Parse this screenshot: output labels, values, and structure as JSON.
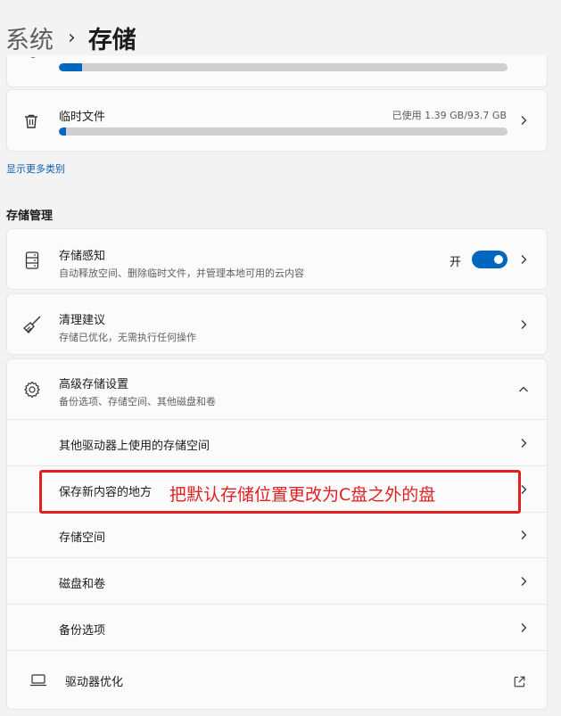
{
  "breadcrumb": {
    "parent": "系统",
    "separator": "›",
    "current": "存储"
  },
  "storage_items": [
    {
      "label": "",
      "usage": "",
      "fill_percent": 5
    },
    {
      "label": "临时文件",
      "usage": "已使用 1.39 GB/93.7 GB",
      "fill_percent": 1.5
    }
  ],
  "show_more_link": "显示更多类别",
  "storage_management": {
    "heading": "存储管理",
    "storage_sense": {
      "title": "存储感知",
      "desc": "自动释放空间、删除临时文件，并管理本地可用的云内容",
      "toggle_label": "开",
      "toggle_on": true
    },
    "cleanup": {
      "title": "清理建议",
      "desc": "存储已优化，无需执行任何操作"
    },
    "advanced": {
      "title": "高级存储设置",
      "desc": "备份选项、存储空间、其他磁盘和卷",
      "sub_items": [
        {
          "label": "其他驱动器上使用的存储空间"
        },
        {
          "label": "保存新内容的地方"
        },
        {
          "label": "存储空间"
        },
        {
          "label": "磁盘和卷"
        },
        {
          "label": "备份选项"
        }
      ]
    },
    "optimize": {
      "title": "驱动器优化"
    }
  },
  "annotation": {
    "text": "把默认存储位置更改为C盘之外的盘",
    "color": "#e02020"
  },
  "colors": {
    "accent": "#0067c0",
    "background": "#f3f3f3",
    "card": "#fbfbfb"
  }
}
